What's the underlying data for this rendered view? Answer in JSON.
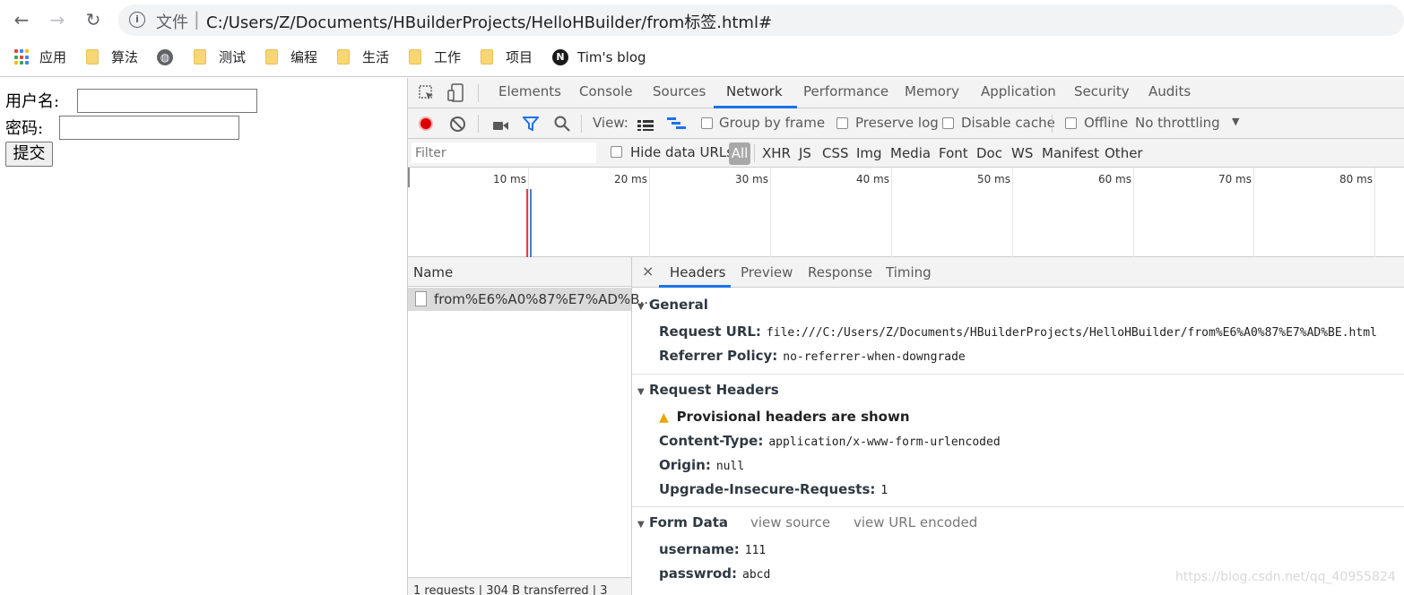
{
  "browser": {
    "nav": {
      "back": "←",
      "forward": "→",
      "reload": "↻"
    },
    "omnibox": {
      "scheme_label": "文件",
      "separator": "|",
      "url": "C:/Users/Z/Documents/HBuilderProjects/HelloHBuilder/from标签.html#"
    }
  },
  "bookmarks": [
    {
      "label": "应用",
      "icon": "apps-grid-icon"
    },
    {
      "label": "算法",
      "icon": "folder-icon"
    },
    {
      "label": "",
      "icon": "globe-icon"
    },
    {
      "label": "测试",
      "icon": "folder-icon"
    },
    {
      "label": "编程",
      "icon": "folder-icon"
    },
    {
      "label": "生活",
      "icon": "folder-icon"
    },
    {
      "label": "工作",
      "icon": "folder-icon"
    },
    {
      "label": "项目",
      "icon": "folder-icon"
    },
    {
      "label": "Tim's blog",
      "icon": "n-logo-icon"
    }
  ],
  "page": {
    "username_label": "用户名:",
    "password_label": "密码:",
    "submit_label": "提交",
    "username_value": "",
    "password_value": ""
  },
  "devtools": {
    "panels": [
      "Elements",
      "Console",
      "Sources",
      "Network",
      "Performance",
      "Memory",
      "Application",
      "Security",
      "Audits"
    ],
    "active_panel": "Network",
    "toolbar": {
      "view_label": "View:",
      "group_by_frame": "Group by frame",
      "preserve_log": "Preserve log",
      "disable_cache": "Disable cache",
      "offline": "Offline",
      "throttling": "No throttling",
      "throttling_arrow": "▼"
    },
    "filter": {
      "placeholder": "Filter",
      "hide_data_urls": "Hide data URLs",
      "types": [
        "All",
        "XHR",
        "JS",
        "CSS",
        "Img",
        "Media",
        "Font",
        "Doc",
        "WS",
        "Manifest",
        "Other"
      ],
      "active_type": "All"
    },
    "timeline_ticks": [
      "10 ms",
      "20 ms",
      "30 ms",
      "40 ms",
      "50 ms",
      "60 ms",
      "70 ms",
      "80 ms"
    ],
    "request_list": {
      "header": "Name",
      "rows": [
        "from%E6%A0%87%E7%AD%B..."
      ],
      "status": "1 requests | 304 B transferred | 3"
    },
    "detail_tabs": [
      "Headers",
      "Preview",
      "Response",
      "Timing"
    ],
    "active_detail_tab": "Headers",
    "close_glyph": "×",
    "general": {
      "title": "General",
      "request_url_key": "Request URL:",
      "request_url_val": "file:///C:/Users/Z/Documents/HBuilderProjects/HelloHBuilder/from%E6%A0%87%E7%AD%BE.html",
      "referrer_key": "Referrer Policy:",
      "referrer_val": "no-referrer-when-downgrade"
    },
    "request_headers": {
      "title": "Request Headers",
      "warning": "Provisional headers are shown",
      "rows": [
        {
          "k": "Content-Type:",
          "v": "application/x-www-form-urlencoded"
        },
        {
          "k": "Origin:",
          "v": "null"
        },
        {
          "k": "Upgrade-Insecure-Requests:",
          "v": "1"
        }
      ]
    },
    "form_data": {
      "title": "Form Data",
      "view_source": "view source",
      "view_url_encoded": "view URL encoded",
      "rows": [
        {
          "k": "username:",
          "v": "111"
        },
        {
          "k": "passwrod:",
          "v": "abcd"
        }
      ]
    }
  },
  "watermark": "https://blog.csdn.net/qq_40955824"
}
